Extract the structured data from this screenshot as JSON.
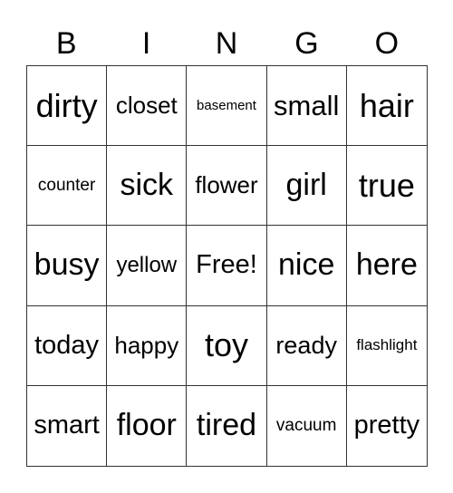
{
  "header": [
    "B",
    "I",
    "N",
    "G",
    "O"
  ],
  "cells": [
    [
      "dirty",
      "closet",
      "basement",
      "small",
      "hair"
    ],
    [
      "counter",
      "sick",
      "flower",
      "girl",
      "true"
    ],
    [
      "busy",
      "yellow",
      "Free!",
      "nice",
      "here"
    ],
    [
      "today",
      "happy",
      "toy",
      "ready",
      "flashlight"
    ],
    [
      "smart",
      "floor",
      "tired",
      "vacuum",
      "pretty"
    ]
  ]
}
